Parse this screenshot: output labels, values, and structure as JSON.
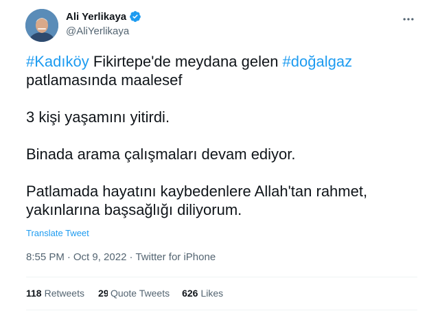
{
  "author": {
    "name": "Ali Yerlikaya",
    "handle": "@AliYerlikaya",
    "verified": true,
    "avatar_icon": "profile-photo"
  },
  "tweet": {
    "line1": {
      "hashtag1": "#Kadıköy",
      "text1": " Fikirtepe'de meydana gelen ",
      "hashtag2": "#doğalgaz"
    },
    "line2": "patlamasında maalesef",
    "para2": "3 kişi yaşamını yitirdi.",
    "para3": "Binada arama çalışmaları devam ediyor.",
    "para4_line1": "Patlamada hayatını kaybedenlere Allah'tan rahmet,",
    "para4_line2": "yakınlarına başsağlığı diliyorum."
  },
  "translate_label": "Translate Tweet",
  "meta": {
    "time": "8:55 PM",
    "dot1": "·",
    "date": "Oct 9, 2022",
    "dot2": "·",
    "source": "Twitter for iPhone"
  },
  "stats": {
    "retweets_count": "118",
    "retweets_label": "Retweets",
    "quotes_count": "29",
    "quotes_label": "Quote Tweets",
    "likes_count": "626",
    "likes_label": "Likes"
  },
  "colors": {
    "accent": "#1d9bf0",
    "text": "#0f1419",
    "secondary": "#536471",
    "divider": "#eff3f4"
  },
  "icons": {
    "verified": "verified-badge-icon",
    "more": "more-options-icon"
  }
}
